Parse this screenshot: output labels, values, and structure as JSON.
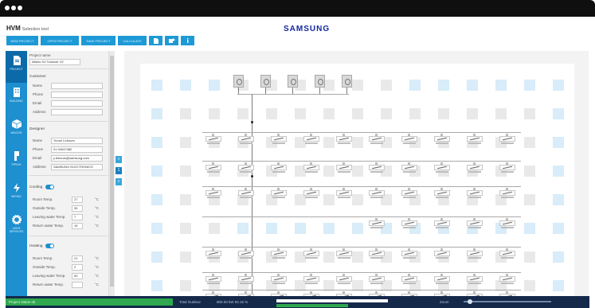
{
  "window": {
    "dots": 3
  },
  "app": {
    "logo": "HVM",
    "logo_sub": "Selection tool",
    "brand": "SAMSUNG"
  },
  "toolbar": {
    "buttons": [
      {
        "label": "NEW PROJECT"
      },
      {
        "label": "OPEN PROJECT"
      },
      {
        "label": "SAVE PROJECT"
      },
      {
        "label": "CALCULATE"
      }
    ],
    "icon_buttons": [
      "document-icon",
      "export-icon",
      "info-icon"
    ],
    "accent": "#1d9ad6"
  },
  "sidebar": {
    "items": [
      {
        "label": "PROJECT",
        "icon": "document-icon",
        "active": true
      },
      {
        "label": "BUILDING",
        "icon": "building-icon",
        "active": false
      },
      {
        "label": "INDOOR",
        "icon": "cube-icon",
        "active": false
      },
      {
        "label": "PIPING",
        "icon": "pipe-icon",
        "active": false
      },
      {
        "label": "WIRING",
        "icon": "bolt-icon",
        "active": false
      },
      {
        "label": "USER SERVICES",
        "icon": "gear-icon",
        "active": false
      }
    ],
    "color": "#1e8fcf"
  },
  "form": {
    "project_name_label": "Project name",
    "project_name": "Alfano D2 Toolover V2",
    "customer_heading": "Customer",
    "customer": {
      "name": "",
      "phone": "",
      "email": "",
      "address": ""
    },
    "labels": {
      "name": "Name",
      "phone": "Phone",
      "email": "Email",
      "address": "Address"
    },
    "designer_heading": "Designer",
    "designer": {
      "name": "Yoonn Lehours",
      "phone": "01 94047480",
      "email": "y.lehours@samsung.com",
      "address": "SAMSUNG ELECTRONICS"
    },
    "cooling": {
      "title": "Cooling",
      "enabled": true,
      "rows": [
        {
          "label": "Room Temp.",
          "value": "27",
          "unit": "°C"
        },
        {
          "label": "Outside Temp.",
          "value": "35",
          "unit": "°C"
        },
        {
          "label": "Leaving water Temp.",
          "value": "7",
          "unit": "°C"
        },
        {
          "label": "Return water Temp.",
          "value": "15",
          "unit": "°C"
        }
      ]
    },
    "heating": {
      "title": "Heating",
      "enabled": true,
      "rows": [
        {
          "label": "Room Temp.",
          "value": "21",
          "unit": "°C"
        },
        {
          "label": "Outside Temp.",
          "value": "2",
          "unit": "°C"
        },
        {
          "label": "Leaving water Temp.",
          "value": "50",
          "unit": "°C"
        },
        {
          "label": "Return water Temp.",
          "value": "",
          "unit": "°C"
        }
      ]
    }
  },
  "side_toggles": [
    "«",
    "1",
    "»"
  ],
  "diagram": {
    "outdoor_units": 5,
    "indoor_rows": 7,
    "indoor_cols": 10
  },
  "status": {
    "left": "Project status ok",
    "mid_label": "Total Outdoor",
    "mid_value": "800.00 kW 93.15 %",
    "right_label": "Zoom",
    "bg": "#15294a",
    "green": "#2fa84f"
  }
}
